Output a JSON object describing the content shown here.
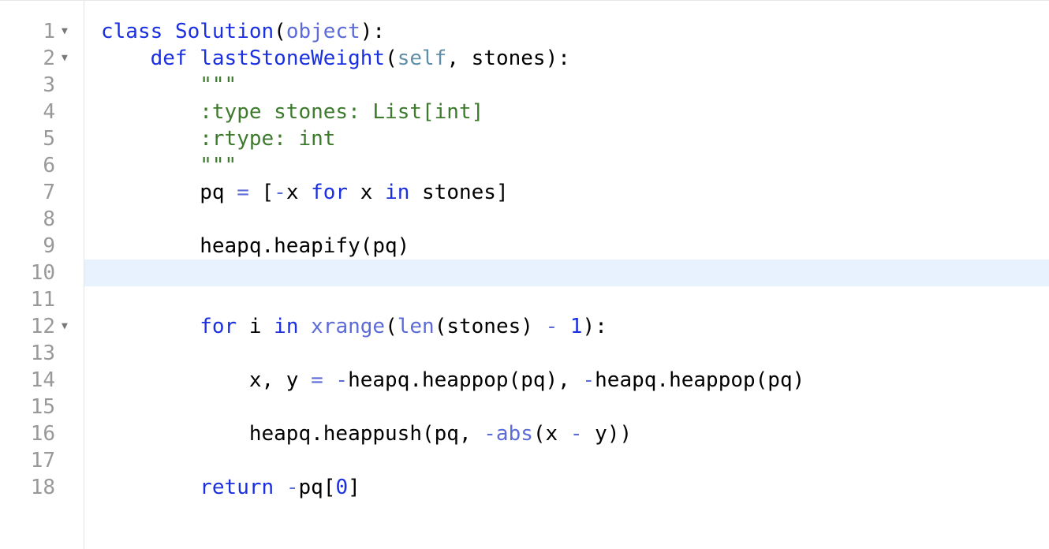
{
  "editor": {
    "active_line": 10,
    "lines": [
      {
        "number": "1",
        "foldable": true,
        "tokens": [
          {
            "t": "class",
            "c": "kw"
          },
          {
            "t": " ",
            "c": "plain"
          },
          {
            "t": "Solution",
            "c": "cls"
          },
          {
            "t": "(",
            "c": "plain"
          },
          {
            "t": "object",
            "c": "builtin-obj"
          },
          {
            "t": "):",
            "c": "plain"
          }
        ]
      },
      {
        "number": "2",
        "foldable": true,
        "tokens": [
          {
            "t": "    ",
            "c": "plain"
          },
          {
            "t": "def",
            "c": "kw"
          },
          {
            "t": " ",
            "c": "plain"
          },
          {
            "t": "lastStoneWeight",
            "c": "def"
          },
          {
            "t": "(",
            "c": "plain"
          },
          {
            "t": "self",
            "c": "self"
          },
          {
            "t": ", stones):",
            "c": "plain"
          }
        ]
      },
      {
        "number": "3",
        "foldable": false,
        "tokens": [
          {
            "t": "        ",
            "c": "plain"
          },
          {
            "t": "\"\"\"",
            "c": "str"
          }
        ]
      },
      {
        "number": "4",
        "foldable": false,
        "tokens": [
          {
            "t": "        ",
            "c": "plain"
          },
          {
            "t": ":type stones: List[int]",
            "c": "str"
          }
        ]
      },
      {
        "number": "5",
        "foldable": false,
        "tokens": [
          {
            "t": "        ",
            "c": "plain"
          },
          {
            "t": ":rtype: int",
            "c": "str"
          }
        ]
      },
      {
        "number": "6",
        "foldable": false,
        "tokens": [
          {
            "t": "        ",
            "c": "plain"
          },
          {
            "t": "\"\"\"",
            "c": "str"
          }
        ]
      },
      {
        "number": "7",
        "foldable": false,
        "tokens": [
          {
            "t": "        pq ",
            "c": "plain"
          },
          {
            "t": "=",
            "c": "op"
          },
          {
            "t": " [",
            "c": "plain"
          },
          {
            "t": "-",
            "c": "op"
          },
          {
            "t": "x ",
            "c": "plain"
          },
          {
            "t": "for",
            "c": "kw"
          },
          {
            "t": " x ",
            "c": "plain"
          },
          {
            "t": "in",
            "c": "kw"
          },
          {
            "t": " stones]",
            "c": "plain"
          }
        ]
      },
      {
        "number": "8",
        "foldable": false,
        "tokens": []
      },
      {
        "number": "9",
        "foldable": false,
        "tokens": [
          {
            "t": "        heapq.heapify(pq)",
            "c": "plain"
          }
        ]
      },
      {
        "number": "10",
        "foldable": false,
        "tokens": []
      },
      {
        "number": "11",
        "foldable": false,
        "tokens": []
      },
      {
        "number": "12",
        "foldable": true,
        "tokens": [
          {
            "t": "        ",
            "c": "plain"
          },
          {
            "t": "for",
            "c": "kw"
          },
          {
            "t": " i ",
            "c": "plain"
          },
          {
            "t": "in",
            "c": "kw"
          },
          {
            "t": " ",
            "c": "plain"
          },
          {
            "t": "xrange",
            "c": "builtin-obj"
          },
          {
            "t": "(",
            "c": "plain"
          },
          {
            "t": "len",
            "c": "builtin-obj"
          },
          {
            "t": "(stones) ",
            "c": "plain"
          },
          {
            "t": "-",
            "c": "op"
          },
          {
            "t": " ",
            "c": "plain"
          },
          {
            "t": "1",
            "c": "num"
          },
          {
            "t": "):",
            "c": "plain"
          }
        ]
      },
      {
        "number": "13",
        "foldable": false,
        "tokens": []
      },
      {
        "number": "14",
        "foldable": false,
        "tokens": [
          {
            "t": "            x, y ",
            "c": "plain"
          },
          {
            "t": "=",
            "c": "op"
          },
          {
            "t": " ",
            "c": "plain"
          },
          {
            "t": "-",
            "c": "op"
          },
          {
            "t": "heapq.heappop(pq), ",
            "c": "plain"
          },
          {
            "t": "-",
            "c": "op"
          },
          {
            "t": "heapq.heappop(pq)",
            "c": "plain"
          }
        ]
      },
      {
        "number": "15",
        "foldable": false,
        "tokens": []
      },
      {
        "number": "16",
        "foldable": false,
        "tokens": [
          {
            "t": "            heapq.heappush(pq, ",
            "c": "plain"
          },
          {
            "t": "-",
            "c": "op"
          },
          {
            "t": "abs",
            "c": "builtin-obj"
          },
          {
            "t": "(x ",
            "c": "plain"
          },
          {
            "t": "-",
            "c": "op"
          },
          {
            "t": " y))",
            "c": "plain"
          }
        ]
      },
      {
        "number": "17",
        "foldable": false,
        "tokens": []
      },
      {
        "number": "18",
        "foldable": false,
        "tokens": [
          {
            "t": "        ",
            "c": "plain"
          },
          {
            "t": "return",
            "c": "kw"
          },
          {
            "t": " ",
            "c": "plain"
          },
          {
            "t": "-",
            "c": "op"
          },
          {
            "t": "pq[",
            "c": "plain"
          },
          {
            "t": "0",
            "c": "num"
          },
          {
            "t": "]",
            "c": "plain"
          }
        ]
      }
    ]
  },
  "icons": {
    "fold": "chevron-down-icon",
    "fold_glyph": "▼"
  },
  "colors": {
    "keyword": "#1a2fe0",
    "string": "#3c7a2c",
    "self": "#5f8fa8",
    "builtin": "#5c6bd8",
    "line_number": "#999999",
    "active_line": "#e8f2fe"
  }
}
